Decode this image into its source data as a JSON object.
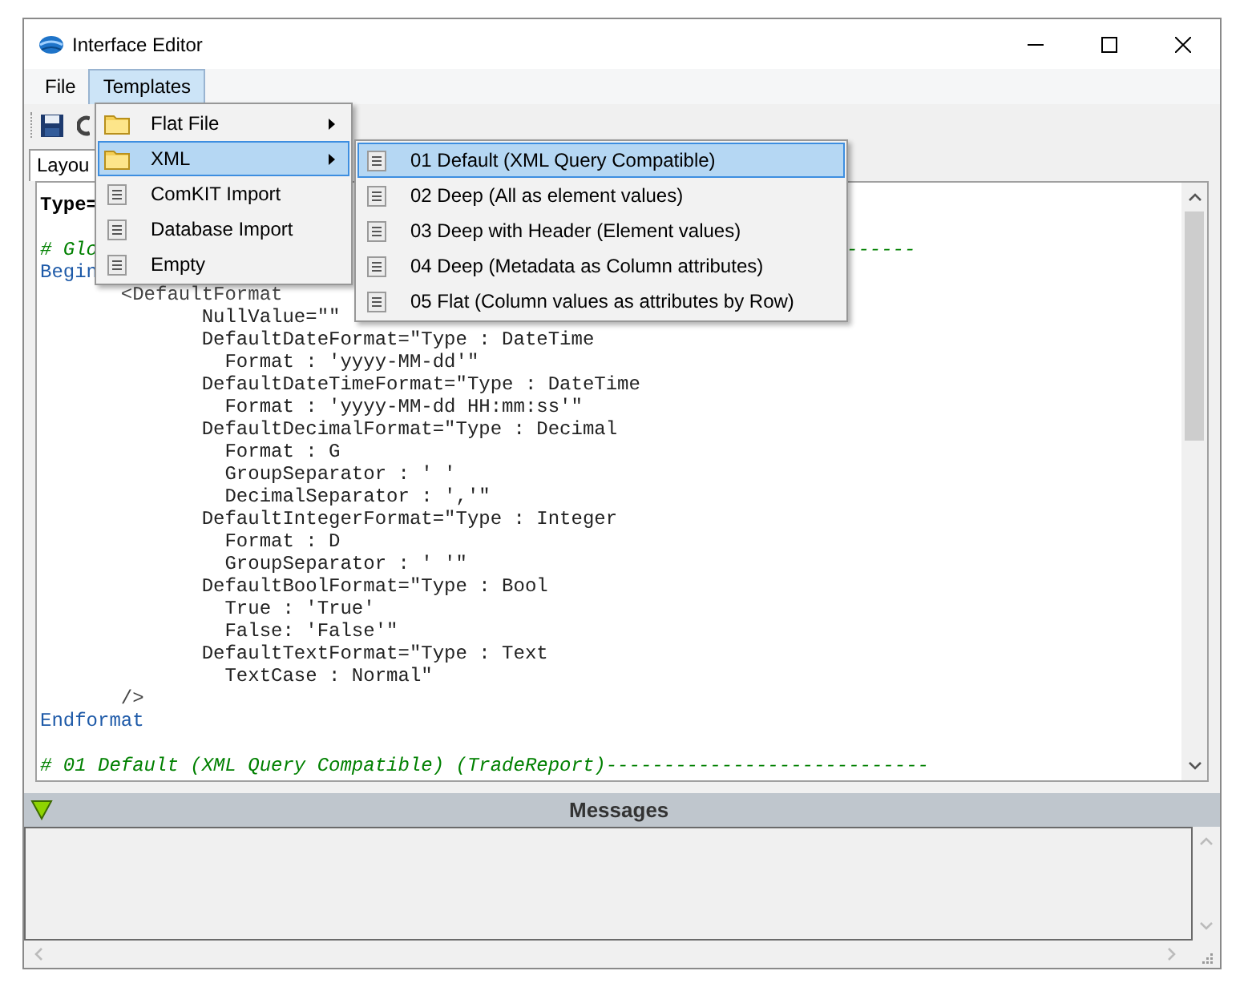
{
  "window": {
    "title": "Interface Editor"
  },
  "menu_bar": [
    {
      "label": "File",
      "selected": false
    },
    {
      "label": "Templates",
      "selected": true
    }
  ],
  "tab": {
    "label": "Layou"
  },
  "editor": {
    "lines": [
      {
        "kind": "type",
        "text": "Type="
      },
      {
        "kind": "blank"
      },
      {
        "kind": "comment",
        "text": "# Glo",
        "tail": "------"
      },
      {
        "kind": "keyword",
        "text": "Begin"
      },
      {
        "kind": "tag",
        "text": "       <DefaultFormat"
      },
      {
        "kind": "attr",
        "text": "              NullValue=\"\""
      },
      {
        "kind": "attr",
        "text": "              DefaultDateFormat=\"Type : DateTime"
      },
      {
        "kind": "attr",
        "text": "                Format : 'yyyy-MM-dd'\""
      },
      {
        "kind": "attr",
        "text": "              DefaultDateTimeFormat=\"Type : DateTime"
      },
      {
        "kind": "attr",
        "text": "                Format : 'yyyy-MM-dd HH:mm:ss'\""
      },
      {
        "kind": "attr",
        "text": "              DefaultDecimalFormat=\"Type : Decimal"
      },
      {
        "kind": "attr",
        "text": "                Format : G"
      },
      {
        "kind": "attr",
        "text": "                GroupSeparator : ' '"
      },
      {
        "kind": "attr",
        "text": "                DecimalSeparator : ','\""
      },
      {
        "kind": "attr",
        "text": "              DefaultIntegerFormat=\"Type : Integer"
      },
      {
        "kind": "attr",
        "text": "                Format : D"
      },
      {
        "kind": "attr",
        "text": "                GroupSeparator : ' '\""
      },
      {
        "kind": "attr",
        "text": "              DefaultBoolFormat=\"Type : Bool"
      },
      {
        "kind": "attr",
        "text": "                True : 'True'"
      },
      {
        "kind": "attr",
        "text": "                False: 'False'\""
      },
      {
        "kind": "attr",
        "text": "              DefaultTextFormat=\"Type : Text"
      },
      {
        "kind": "attr",
        "text": "                TextCase : Normal\""
      },
      {
        "kind": "tag",
        "text": "       />"
      },
      {
        "kind": "keyword",
        "text": "Endformat"
      },
      {
        "kind": "blank"
      },
      {
        "kind": "comment",
        "text": "# 01 Default (XML Query Compatible) (TradeReport)----------------------------"
      }
    ]
  },
  "templates_menu": {
    "items": [
      {
        "label": "Flat File",
        "kind": "folder",
        "submenu": true,
        "selected": false
      },
      {
        "label": "XML",
        "kind": "folder",
        "submenu": true,
        "selected": true
      },
      {
        "label": "ComKIT Import",
        "kind": "document",
        "submenu": false,
        "selected": false
      },
      {
        "label": "Database Import",
        "kind": "document",
        "submenu": false,
        "selected": false
      },
      {
        "label": "Empty",
        "kind": "document",
        "submenu": false,
        "selected": false
      }
    ]
  },
  "xml_submenu": {
    "items": [
      {
        "label": "01 Default (XML Query Compatible)",
        "kind": "document",
        "selected": true
      },
      {
        "label": "02 Deep (All as element values)",
        "kind": "document",
        "selected": false
      },
      {
        "label": "03 Deep with Header (Element values)",
        "kind": "document",
        "selected": false
      },
      {
        "label": "04 Deep (Metadata as Column attributes)",
        "kind": "document",
        "selected": false
      },
      {
        "label": "05 Flat (Column values as attributes by Row)",
        "kind": "document",
        "selected": false
      }
    ]
  },
  "messages_panel": {
    "title": "Messages"
  }
}
